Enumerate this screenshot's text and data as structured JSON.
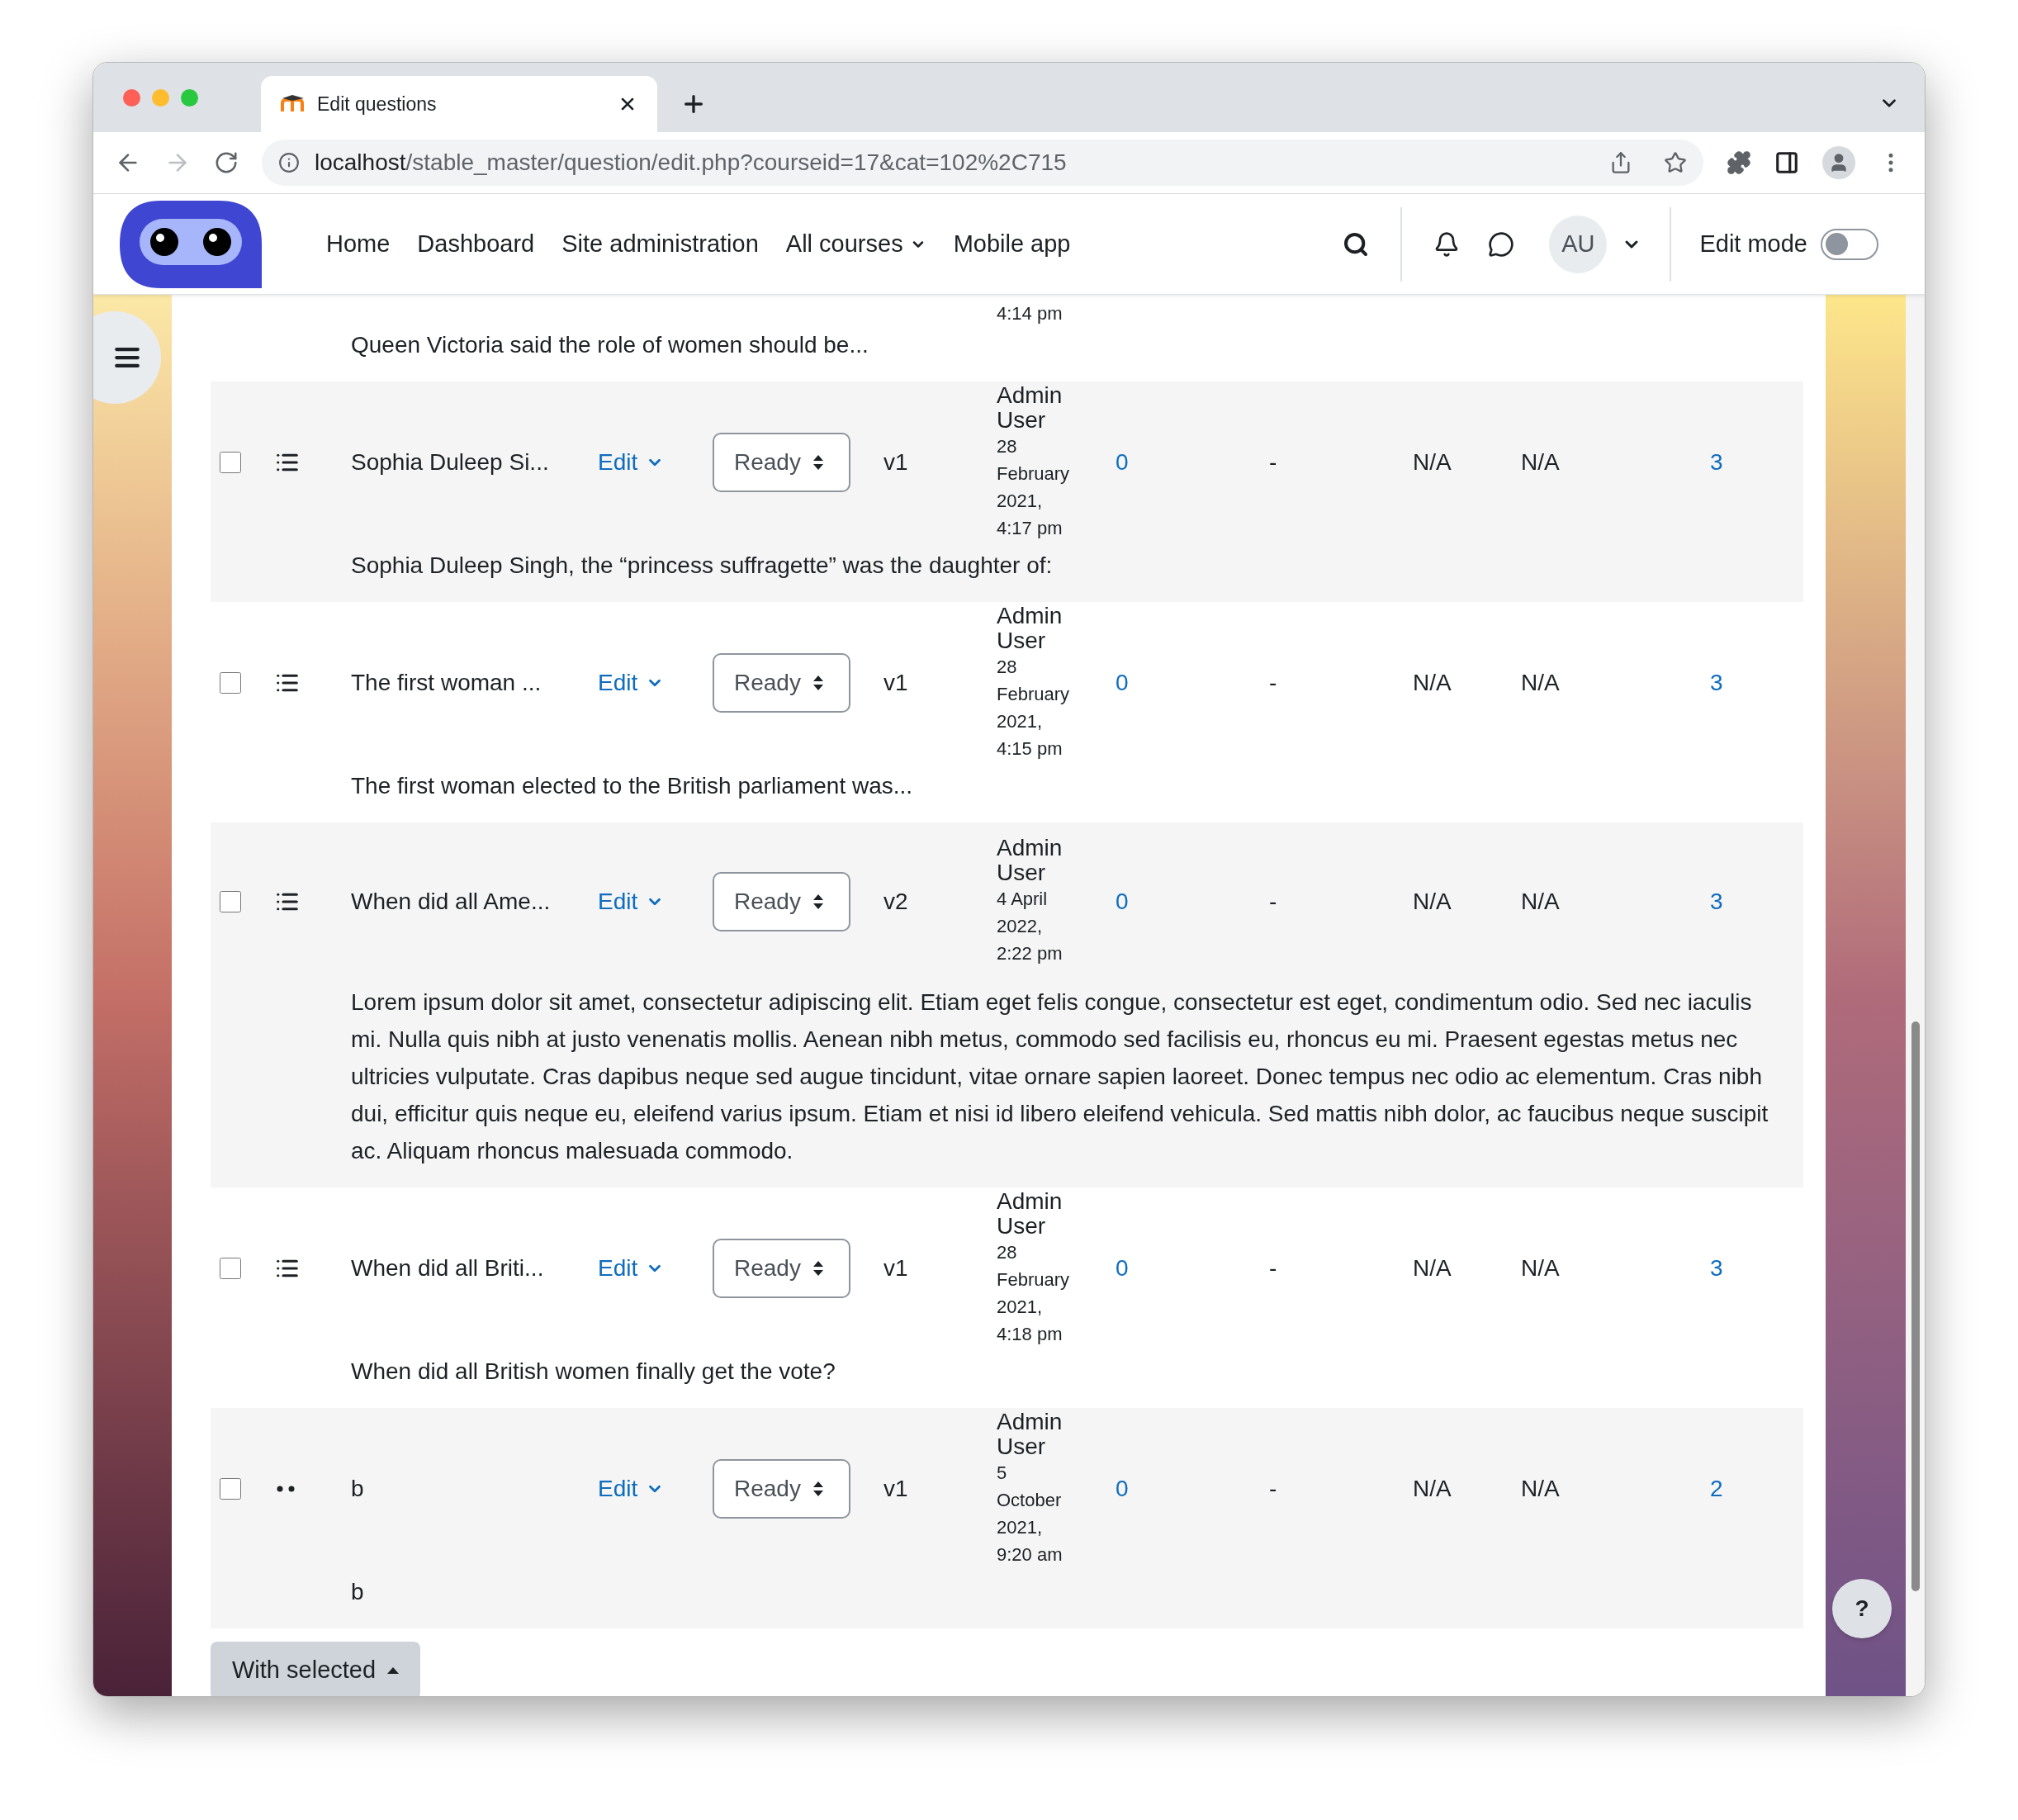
{
  "browser": {
    "tab_title": "Edit questions",
    "url_host": "localhost",
    "url_path": "/stable_master/question/edit.php?courseid=17&cat=102%2C715"
  },
  "nav": {
    "items": [
      {
        "label": "Home",
        "has_menu": false
      },
      {
        "label": "Dashboard",
        "has_menu": false
      },
      {
        "label": "Site administration",
        "has_menu": false
      },
      {
        "label": "All courses",
        "has_menu": true
      },
      {
        "label": "Mobile app",
        "has_menu": false
      }
    ],
    "avatar": "AU",
    "edit_mode": {
      "label": "Edit mode",
      "on": false
    }
  },
  "partial_row": {
    "date": "4:14 pm",
    "description": "Queen Victoria said the role of women should be..."
  },
  "questions": [
    {
      "kind": "multichoice",
      "checked": false,
      "name": "Sophia Duleep Si...",
      "action": "Edit",
      "status": "Ready",
      "version": "v1",
      "author": "Admin User",
      "date": "28 February 2021, 4:17 pm",
      "column_8": "0",
      "column_9": "-",
      "column_10": "N/A",
      "column_11": "N/A",
      "column_12": "3",
      "description": "Sophia Duleep Singh, the “princess suffragette” was the daughter of:"
    },
    {
      "kind": "multichoice",
      "checked": false,
      "name": "The first woman ...",
      "action": "Edit",
      "status": "Ready",
      "version": "v1",
      "author": "Admin User",
      "date": "28 February 2021, 4:15 pm",
      "column_8": "0",
      "column_9": "-",
      "column_10": "N/A",
      "column_11": "N/A",
      "column_12": "3",
      "description": "The first woman elected to the British parliament was..."
    },
    {
      "kind": "multichoice",
      "checked": false,
      "name": "When did all Ame...",
      "action": "Edit",
      "status": "Ready",
      "version": "v2",
      "author": "Admin User",
      "date": "4 April 2022, 2:22 pm",
      "column_8": "0",
      "column_9": "-",
      "column_10": "N/A",
      "column_11": "N/A",
      "column_12": "3",
      "description": "Lorem ipsum dolor sit amet, consectetur adipiscing elit. Etiam eget felis congue, consectetur est eget, condimentum odio. Sed nec iaculis mi. Nulla quis nibh at justo venenatis mollis. Aenean nibh metus, commodo sed facilisis eu, rhoncus eu mi. Praesent egestas metus nec ultricies vulputate. Cras dapibus neque sed augue tincidunt, vitae ornare sapien laoreet. Donec tempus nec odio ac elementum. Cras nibh dui, efficitur quis neque eu, eleifend varius ipsum. Etiam et nisi id libero eleifend vehicula. Sed mattis nibh dolor, ac faucibus neque suscipit ac. Aliquam rhoncus malesuada commodo."
    },
    {
      "kind": "multichoice",
      "checked": false,
      "name": "When did all Briti...",
      "action": "Edit",
      "status": "Ready",
      "version": "v1",
      "author": "Admin User",
      "date": "28 February 2021, 4:18 pm",
      "column_8": "0",
      "column_9": "-",
      "column_10": "N/A",
      "column_11": "N/A",
      "column_12": "3",
      "description": "When did all British women finally get the vote?"
    },
    {
      "kind": "dots",
      "checked": false,
      "name": "b",
      "action": "Edit",
      "status": "Ready",
      "version": "v1",
      "author": "Admin User",
      "date": "5 October 2021, 9:20 am",
      "column_8": "0",
      "column_9": "-",
      "column_10": "N/A",
      "column_11": "N/A",
      "column_12": "2",
      "description": "b"
    }
  ],
  "bulk_button": "With selected",
  "help_button": "?"
}
